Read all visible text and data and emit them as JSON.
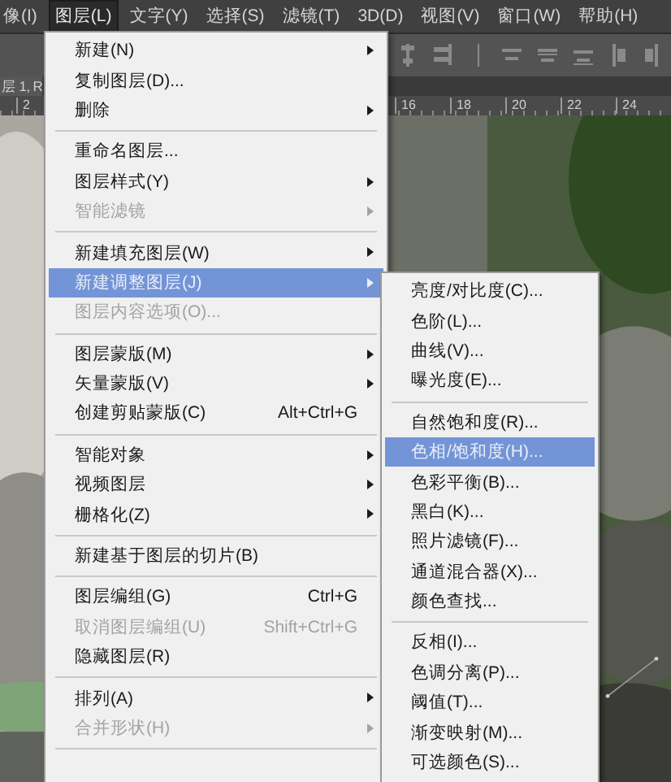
{
  "menu_bar": [
    {
      "label": "像(I)",
      "selected": false
    },
    {
      "label": "图层(L)",
      "selected": true
    },
    {
      "label": "文字(Y)",
      "selected": false
    },
    {
      "label": "选择(S)",
      "selected": false
    },
    {
      "label": "滤镜(T)",
      "selected": false
    },
    {
      "label": "3D(D)",
      "selected": false
    },
    {
      "label": "视图(V)",
      "selected": false
    },
    {
      "label": "窗口(W)",
      "selected": false
    },
    {
      "label": "帮助(H)",
      "selected": false
    }
  ],
  "document_tab": {
    "title": "层 1, R"
  },
  "ruler": {
    "labels": [
      "2",
      "16",
      "18",
      "20",
      "22",
      "24"
    ]
  },
  "layer_menu": [
    {
      "kind": "item",
      "label": "新建(N)",
      "submenu": true,
      "disabled": false,
      "selected": false
    },
    {
      "kind": "item",
      "label": "复制图层(D)...",
      "submenu": false,
      "disabled": false,
      "selected": false
    },
    {
      "kind": "item",
      "label": "删除",
      "submenu": true,
      "disabled": false,
      "selected": false
    },
    {
      "kind": "separator"
    },
    {
      "kind": "item",
      "label": "重命名图层...",
      "submenu": false,
      "disabled": false,
      "selected": false
    },
    {
      "kind": "item",
      "label": "图层样式(Y)",
      "submenu": true,
      "disabled": false,
      "selected": false
    },
    {
      "kind": "item",
      "label": "智能滤镜",
      "submenu": true,
      "disabled": true,
      "selected": false
    },
    {
      "kind": "separator"
    },
    {
      "kind": "item",
      "label": "新建填充图层(W)",
      "submenu": true,
      "disabled": false,
      "selected": false
    },
    {
      "kind": "item",
      "label": "新建调整图层(J)",
      "submenu": true,
      "disabled": false,
      "selected": true
    },
    {
      "kind": "item",
      "label": "图层内容选项(O)...",
      "submenu": false,
      "disabled": true,
      "selected": false
    },
    {
      "kind": "separator"
    },
    {
      "kind": "item",
      "label": "图层蒙版(M)",
      "submenu": true,
      "disabled": false,
      "selected": false
    },
    {
      "kind": "item",
      "label": "矢量蒙版(V)",
      "submenu": true,
      "disabled": false,
      "selected": false
    },
    {
      "kind": "item",
      "label": "创建剪贴蒙版(C)",
      "shortcut": "Alt+Ctrl+G",
      "submenu": false,
      "disabled": false,
      "selected": false
    },
    {
      "kind": "separator"
    },
    {
      "kind": "item",
      "label": "智能对象",
      "submenu": true,
      "disabled": false,
      "selected": false
    },
    {
      "kind": "item",
      "label": "视频图层",
      "submenu": true,
      "disabled": false,
      "selected": false
    },
    {
      "kind": "item",
      "label": "栅格化(Z)",
      "submenu": true,
      "disabled": false,
      "selected": false
    },
    {
      "kind": "separator"
    },
    {
      "kind": "item",
      "label": "新建基于图层的切片(B)",
      "submenu": false,
      "disabled": false,
      "selected": false
    },
    {
      "kind": "separator"
    },
    {
      "kind": "item",
      "label": "图层编组(G)",
      "shortcut": "Ctrl+G",
      "submenu": false,
      "disabled": false,
      "selected": false
    },
    {
      "kind": "item",
      "label": "取消图层编组(U)",
      "shortcut": "Shift+Ctrl+G",
      "submenu": false,
      "disabled": true,
      "selected": false
    },
    {
      "kind": "item",
      "label": "隐藏图层(R)",
      "submenu": false,
      "disabled": false,
      "selected": false
    },
    {
      "kind": "separator"
    },
    {
      "kind": "item",
      "label": "排列(A)",
      "submenu": true,
      "disabled": false,
      "selected": false
    },
    {
      "kind": "item",
      "label": "合并形状(H)",
      "submenu": true,
      "disabled": true,
      "selected": false
    },
    {
      "kind": "separator"
    }
  ],
  "adjustment_submenu": [
    {
      "kind": "item",
      "label": "亮度/对比度(C)...",
      "selected": false
    },
    {
      "kind": "item",
      "label": "色阶(L)...",
      "selected": false
    },
    {
      "kind": "item",
      "label": "曲线(V)...",
      "selected": false
    },
    {
      "kind": "item",
      "label": "曝光度(E)...",
      "selected": false
    },
    {
      "kind": "separator"
    },
    {
      "kind": "item",
      "label": "自然饱和度(R)...",
      "selected": false
    },
    {
      "kind": "item",
      "label": "色相/饱和度(H)...",
      "selected": true
    },
    {
      "kind": "item",
      "label": "色彩平衡(B)...",
      "selected": false
    },
    {
      "kind": "item",
      "label": "黑白(K)...",
      "selected": false
    },
    {
      "kind": "item",
      "label": "照片滤镜(F)...",
      "selected": false
    },
    {
      "kind": "item",
      "label": "通道混合器(X)...",
      "selected": false
    },
    {
      "kind": "item",
      "label": "颜色查找...",
      "selected": false
    },
    {
      "kind": "separator"
    },
    {
      "kind": "item",
      "label": "反相(I)...",
      "selected": false
    },
    {
      "kind": "item",
      "label": "色调分离(P)...",
      "selected": false
    },
    {
      "kind": "item",
      "label": "阈值(T)...",
      "selected": false
    },
    {
      "kind": "item",
      "label": "渐变映射(M)...",
      "selected": false
    },
    {
      "kind": "item",
      "label": "可选颜色(S)...",
      "selected": false
    }
  ]
}
